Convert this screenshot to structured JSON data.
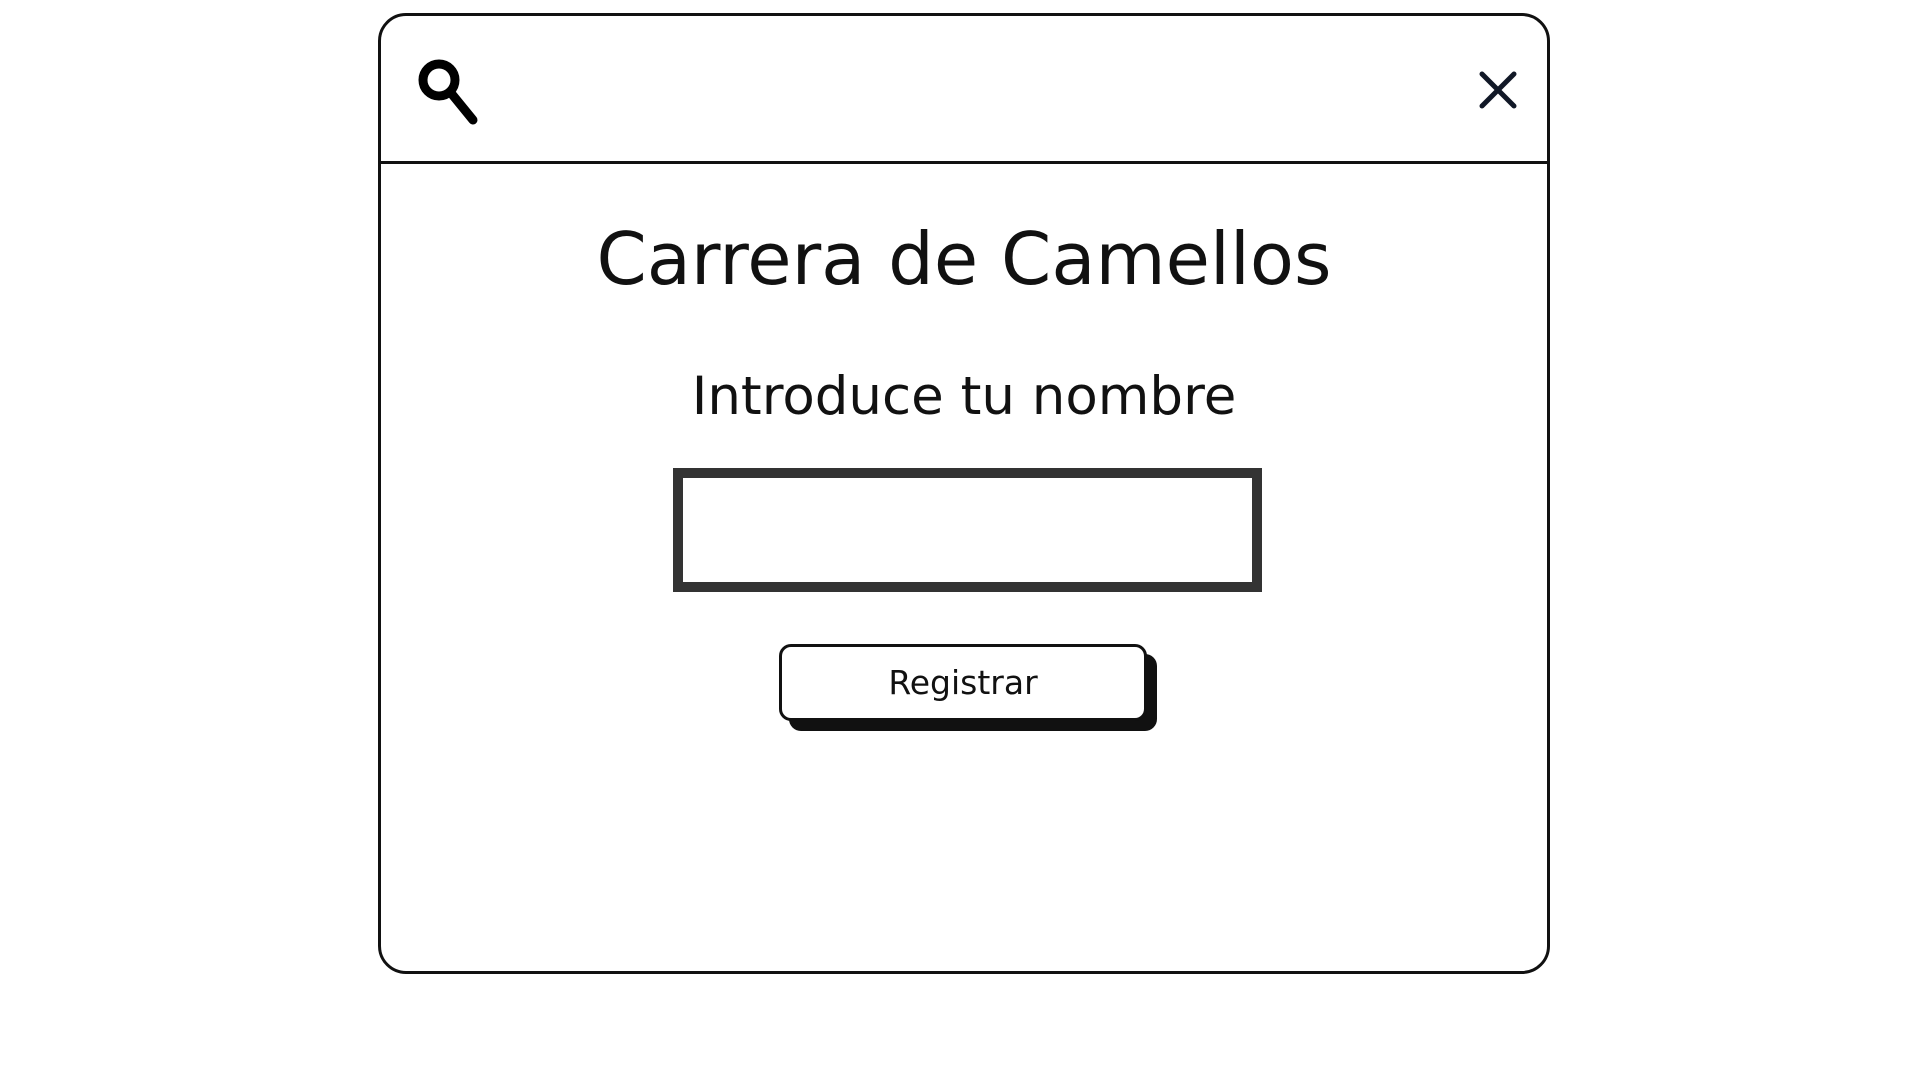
{
  "window": {
    "icons": {
      "search": "search-icon",
      "close": "close-icon"
    }
  },
  "main": {
    "title": "Carrera de Camellos",
    "prompt": "Introduce tu nombre",
    "name_input": {
      "value": "",
      "placeholder": ""
    },
    "register_label": "Registrar"
  },
  "colors": {
    "border": "#111111",
    "input_border": "#333333",
    "background": "#ffffff"
  }
}
